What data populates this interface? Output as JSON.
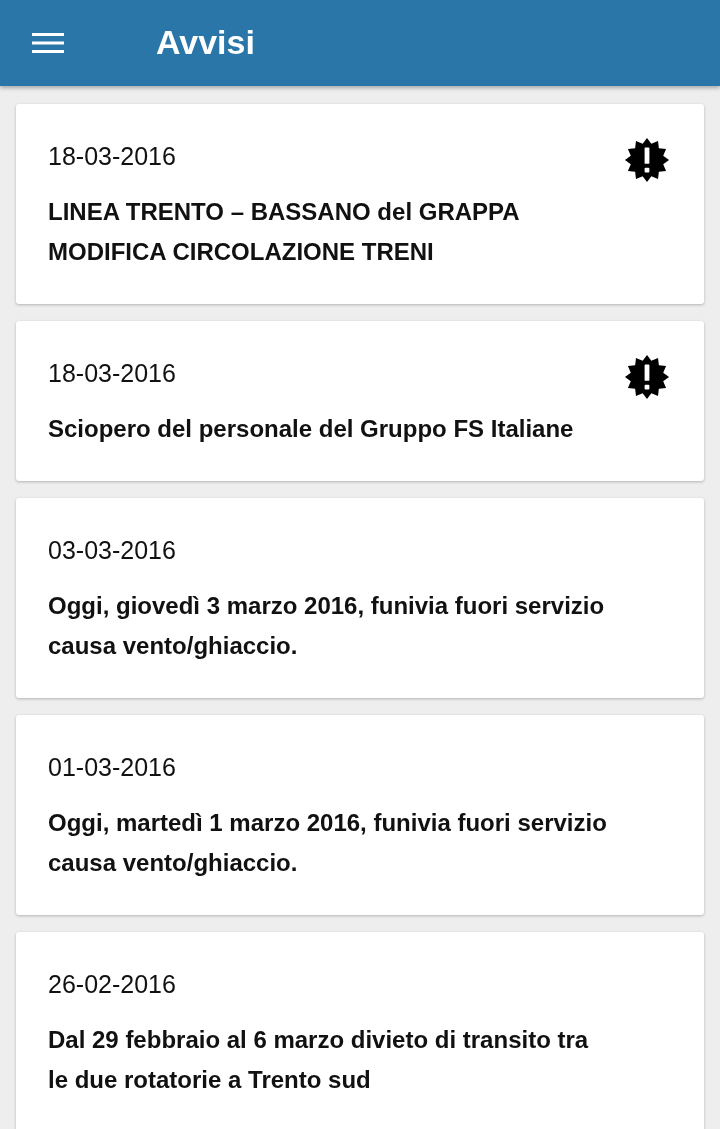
{
  "app_bar": {
    "title": "Avvisi"
  },
  "notices": [
    {
      "date": "18-03-2016",
      "title": "LINEA TRENTO – BASSANO del GRAPPA MODIFICA CIRCOLAZIONE TRENI",
      "important": true
    },
    {
      "date": "18-03-2016",
      "title": "Sciopero del personale del Gruppo FS Italiane",
      "important": true
    },
    {
      "date": "03-03-2016",
      "title": "Oggi, giovedì 3 marzo 2016, funivia fuori servizio causa vento/ghiaccio.",
      "important": false
    },
    {
      "date": "01-03-2016",
      "title": "Oggi, martedì 1 marzo 2016, funivia fuori servizio causa vento/ghiaccio.",
      "important": false
    },
    {
      "date": "26-02-2016",
      "title": "Dal 29 febbraio al 6 marzo divieto di transito tra le due rotatorie a Trento sud",
      "important": false
    }
  ]
}
